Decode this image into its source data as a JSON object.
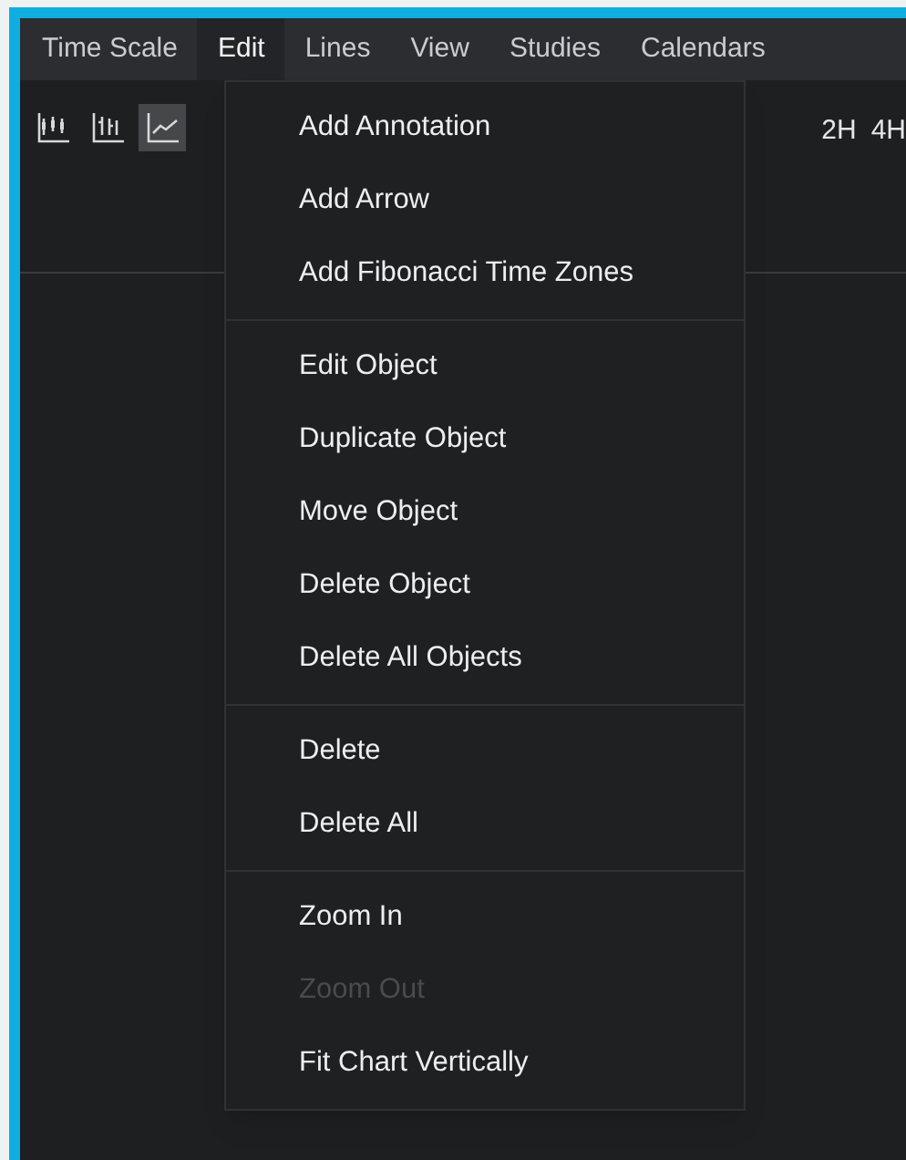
{
  "menu_bar": [
    {
      "label": "Time Scale",
      "selected": false
    },
    {
      "label": "Edit",
      "selected": true
    },
    {
      "label": "Lines",
      "selected": false
    },
    {
      "label": "View",
      "selected": false
    },
    {
      "label": "Studies",
      "selected": false
    },
    {
      "label": "Calendars",
      "selected": false
    }
  ],
  "toolbar": {
    "chart_types": [
      {
        "kind": "candles",
        "selected": false
      },
      {
        "kind": "bars",
        "selected": false
      },
      {
        "kind": "line",
        "selected": true
      }
    ],
    "intervals": [
      "2H",
      "4H"
    ]
  },
  "edit_menu": {
    "groups": [
      [
        {
          "label": "Add Annotation",
          "disabled": false
        },
        {
          "label": "Add Arrow",
          "disabled": false
        },
        {
          "label": "Add Fibonacci Time Zones",
          "disabled": false
        }
      ],
      [
        {
          "label": "Edit Object",
          "disabled": false
        },
        {
          "label": "Duplicate Object",
          "disabled": false
        },
        {
          "label": "Move Object",
          "disabled": false
        },
        {
          "label": "Delete Object",
          "disabled": false
        },
        {
          "label": "Delete All Objects",
          "disabled": false
        }
      ],
      [
        {
          "label": "Delete",
          "disabled": false
        },
        {
          "label": "Delete All",
          "disabled": false
        }
      ],
      [
        {
          "label": "Zoom In",
          "disabled": false
        },
        {
          "label": "Zoom Out",
          "disabled": true
        },
        {
          "label": "Fit Chart Vertically",
          "disabled": false
        }
      ]
    ]
  }
}
